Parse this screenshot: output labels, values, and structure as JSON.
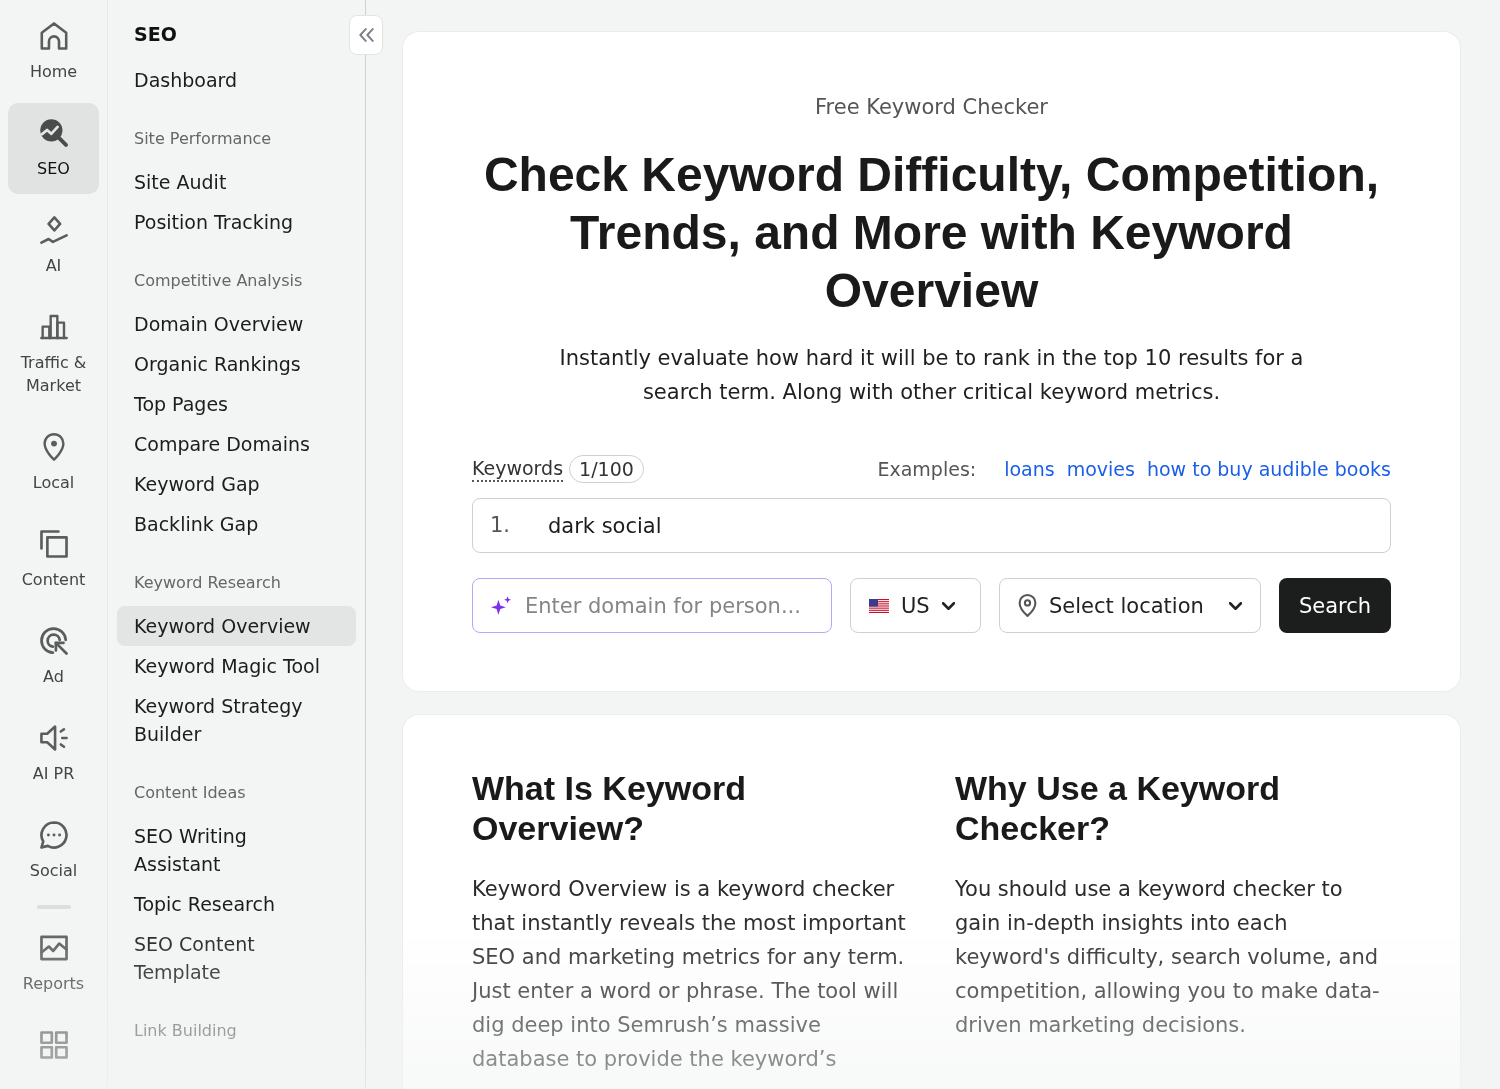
{
  "rail": {
    "items": [
      {
        "label": "Home",
        "selected": false
      },
      {
        "label": "SEO",
        "selected": true
      },
      {
        "label": "AI",
        "selected": false
      },
      {
        "label": "Traffic & Market",
        "selected": false
      },
      {
        "label": "Local",
        "selected": false
      },
      {
        "label": "Content",
        "selected": false
      },
      {
        "label": "Ad",
        "selected": false
      },
      {
        "label": "AI PR",
        "selected": false
      },
      {
        "label": "Social",
        "selected": false
      }
    ],
    "more_items": [
      {
        "label": "Reports",
        "selected": false
      },
      {
        "selected": false
      }
    ]
  },
  "sidebar": {
    "title": "SEO",
    "groups": [
      {
        "items": [
          {
            "label": "Dashboard",
            "selected": false
          }
        ]
      },
      {
        "heading": "Site Performance",
        "items": [
          {
            "label": "Site Audit",
            "selected": false
          },
          {
            "label": "Position Tracking",
            "selected": false
          }
        ]
      },
      {
        "heading": "Competitive Analysis",
        "items": [
          {
            "label": "Domain Overview",
            "selected": false
          },
          {
            "label": "Organic Rankings",
            "selected": false
          },
          {
            "label": "Top Pages",
            "selected": false
          },
          {
            "label": "Compare Domains",
            "selected": false
          },
          {
            "label": "Keyword Gap",
            "selected": false
          },
          {
            "label": "Backlink Gap",
            "selected": false
          }
        ]
      },
      {
        "heading": "Keyword Research",
        "items": [
          {
            "label": "Keyword Overview",
            "selected": true
          },
          {
            "label": "Keyword Magic Tool",
            "selected": false
          },
          {
            "label": "Keyword Strategy Builder",
            "selected": false
          }
        ]
      },
      {
        "heading": "Content Ideas",
        "items": [
          {
            "label": "SEO Writing Assistant",
            "selected": false
          },
          {
            "label": "Topic Research",
            "selected": false
          },
          {
            "label": "SEO Content Template",
            "selected": false
          }
        ]
      },
      {
        "heading": "Link Building"
      }
    ]
  },
  "hero": {
    "eyebrow": "Free Keyword Checker",
    "title": "Check Keyword Difficulty, Competition, Trends, and More with Keyword Overview",
    "subtitle": "Instantly evaluate how hard it will be to rank in the top 10 results for a search term. Along with other critical keyword metrics."
  },
  "keyword_form": {
    "label": "Keywords",
    "count": "1/100",
    "examples_label": "Examples:",
    "examples": [
      "loans",
      "movies",
      "how to buy audible books"
    ],
    "keywords": [
      {
        "number": "1.",
        "value": "dark social"
      }
    ],
    "domain_field": {
      "placeholder": "Enter domain for person..."
    },
    "country_select": {
      "value": "US"
    },
    "location_select": {
      "value": "Select location"
    },
    "search_button": {
      "label": "Search"
    }
  },
  "info": {
    "columns": [
      {
        "heading": "What Is Keyword Overview?",
        "body": "Keyword Overview is a keyword checker that instantly reveals the most important SEO and marketing metrics for any term. Just enter a word or phrase. The tool will dig deep into Semrush’s massive database to provide the keyword’s"
      },
      {
        "heading": "Why Use a Keyword Checker?",
        "body": "You should use a keyword checker to gain in-depth insights into each keyword's difficulty, search volume, and competition, allowing you to make data-driven marketing decisions."
      }
    ]
  }
}
